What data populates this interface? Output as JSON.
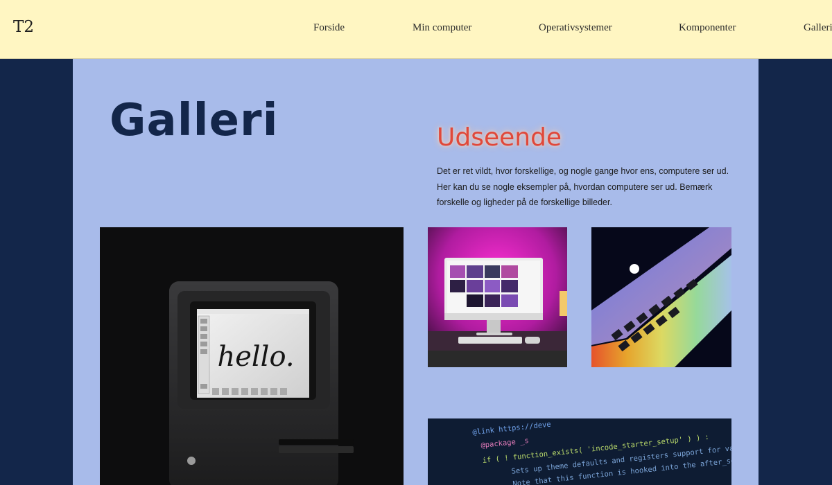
{
  "header": {
    "logo": "T2",
    "nav": [
      "Forside",
      "Min computer",
      "Operativsystemer",
      "Komponenter",
      "Galleri"
    ]
  },
  "main": {
    "title": "Galleri",
    "section_title": "Udseende",
    "intro": "Det er ret vildt, hvor forskellige, og nogle gange hvor ens, computere ser ud. Her kan du se nogle eksempler på, hvordan computere ser ud. Bemærk forskelle og ligheder på de forskellige billeder."
  },
  "gallery": {
    "mac_screen_text": "hello.",
    "code_lines": [
      "@link https://deve",
      "@package _s",
      "if ( ! function_exists( 'incode_starter_setup' ) ) :",
      "Sets up theme defaults and registers support for various WordPress",
      "Note that this function is hooked into the after_setup_theme hook"
    ]
  },
  "colors": {
    "header_bg": "#fff6c2",
    "page_bg": "#13264a",
    "panel_bg": "#a8bbea",
    "title_color": "#13264a",
    "accent": "#e0483a"
  }
}
